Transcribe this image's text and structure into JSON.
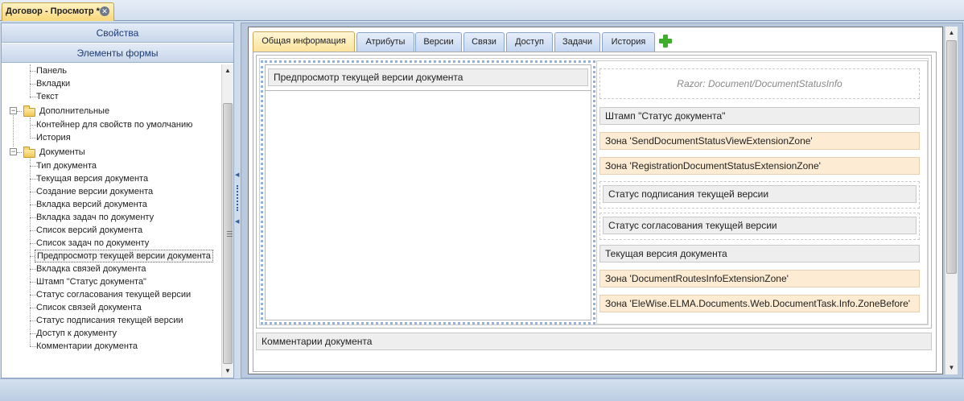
{
  "doc_tab": {
    "title": "Договор - Просмотр *",
    "close": "✕"
  },
  "accordion": {
    "properties": "Свойства",
    "form_elements": "Элементы формы"
  },
  "tree": [
    {
      "label": "Панель"
    },
    {
      "label": "Вкладки"
    },
    {
      "label": "Текст"
    },
    {
      "label": "Дополнительные",
      "folder": true,
      "expander": "−"
    },
    {
      "label": "Контейнер для свойств по умолчанию"
    },
    {
      "label": "История"
    },
    {
      "label": "Документы",
      "folder": true,
      "expander": "−"
    },
    {
      "label": "Тип документа"
    },
    {
      "label": "Текущая версия документа"
    },
    {
      "label": "Создание версии документа"
    },
    {
      "label": "Вкладка версий документа"
    },
    {
      "label": "Вкладка задач по документу"
    },
    {
      "label": "Список версий документа"
    },
    {
      "label": "Список задач по документу"
    },
    {
      "label": "Предпросмотр текущей версии документа",
      "selected": true
    },
    {
      "label": "Вкладка связей документа"
    },
    {
      "label": "Штамп \"Статус документа\""
    },
    {
      "label": "Статус согласования текущей версии"
    },
    {
      "label": "Список связей документа"
    },
    {
      "label": "Статус подписания текущей версии"
    },
    {
      "label": "Доступ к документу"
    },
    {
      "label": "Комментарии документа"
    }
  ],
  "scroll": {
    "up": "▲",
    "down": "▼"
  },
  "splitter": {
    "arrow": "◀"
  },
  "form_tabs": [
    {
      "label": "Общая информация",
      "active": true
    },
    {
      "label": "Атрибуты"
    },
    {
      "label": "Версии"
    },
    {
      "label": "Связи"
    },
    {
      "label": "Доступ"
    },
    {
      "label": "Задачи"
    },
    {
      "label": "История"
    }
  ],
  "layout": {
    "preview_title": "Предпросмотр текущей версии документа",
    "razor": "Razor: Document/DocumentStatusInfo",
    "stamp": "Штамп \"Статус документа\"",
    "zone_send": "Зона 'SendDocumentStatusViewExtensionZone'",
    "zone_registration": "Зона 'RegistrationDocumentStatusExtensionZone'",
    "sign_status": "Статус подписания текущей версии",
    "approval_status": "Статус согласования текущей версии",
    "current_version": "Текущая версия документа",
    "zone_routes": "Зона 'DocumentRoutesInfoExtensionZone'",
    "zone_task": "Зона 'EleWise.ELMA.Documents.Web.DocumentTask.Info.ZoneBefore'",
    "comments": "Комментарии документа"
  },
  "colors": {
    "active_tab": "#fbe29a",
    "zone": "#fdebd3",
    "add_icon": "#3fae2a"
  }
}
